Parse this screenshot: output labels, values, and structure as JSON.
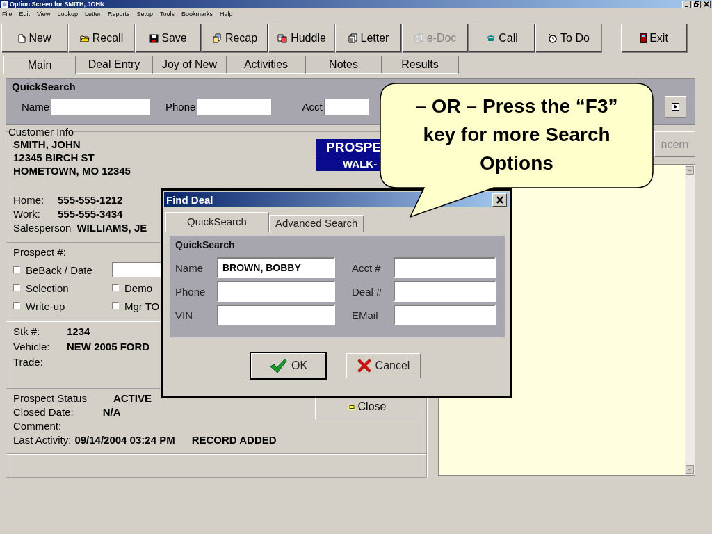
{
  "window": {
    "title": "Option Screen for SMITH, JOHN"
  },
  "menu": [
    "File",
    "Edit",
    "View",
    "Lookup",
    "Letter",
    "Reports",
    "Setup",
    "Tools",
    "Bookmarks",
    "Help"
  ],
  "toolbar": [
    {
      "label": "New",
      "disabled": false
    },
    {
      "label": "Recall",
      "disabled": false
    },
    {
      "label": "Save",
      "disabled": false
    },
    {
      "label": "Recap",
      "disabled": false
    },
    {
      "label": "Huddle",
      "disabled": false
    },
    {
      "label": "Letter",
      "disabled": false
    },
    {
      "label": "e-Doc",
      "disabled": true
    },
    {
      "label": "Call",
      "disabled": false
    },
    {
      "label": "To Do",
      "disabled": false
    },
    {
      "label": "Exit",
      "disabled": false
    }
  ],
  "tabs": [
    {
      "label": "Main",
      "selected": true
    },
    {
      "label": "Deal Entry",
      "selected": false
    },
    {
      "label": "Joy of New",
      "selected": false
    },
    {
      "label": "Activities",
      "selected": false
    },
    {
      "label": "Notes",
      "selected": false
    },
    {
      "label": "Results",
      "selected": false
    }
  ],
  "quick_search": {
    "title": "QuickSearch",
    "fields": [
      {
        "label": "Name"
      },
      {
        "label": "Phone"
      },
      {
        "label": "Acct"
      }
    ]
  },
  "customer_info": {
    "legend": "Customer Info",
    "address": [
      "SMITH, JOHN",
      "12345 BIRCH ST",
      "HOMETOWN, MO  12345"
    ],
    "banner": [
      "PROSPE",
      "WALK-"
    ],
    "contacts": [
      {
        "label": "Home:",
        "value": "555-555-1212"
      },
      {
        "label": "Work:",
        "value": "555-555-3434"
      },
      {
        "label": "Salesperson",
        "value": "WILLIAMS, JE"
      }
    ],
    "prospect_label": "Prospect #:",
    "checks": [
      {
        "label": "BeBack / Date",
        "checked": false
      },
      {
        "label": "Selection",
        "checked": false
      },
      {
        "label": "Demo",
        "checked": false
      },
      {
        "label": "Write-up",
        "checked": false
      },
      {
        "label": "Mgr TO",
        "checked": false
      }
    ],
    "vehicle": [
      {
        "label": "Stk #:",
        "value": "1234"
      },
      {
        "label": "Vehicle:",
        "value": "NEW 2005 FORD"
      },
      {
        "label": "Trade:"
      }
    ],
    "status": [
      {
        "label": "Prospect Status",
        "value": "ACTIVE"
      },
      {
        "label": "Closed Date:",
        "value": "N/A"
      },
      {
        "label": "Comment:"
      },
      {
        "label": "Last Activity:",
        "value": "09/14/2004 03:24 PM",
        "extra": "RECORD ADDED"
      }
    ],
    "close_button": "Close"
  },
  "concern_button": {
    "label": "ncern",
    "disabled": true
  },
  "dialog": {
    "title": "Find Deal",
    "tabs": [
      {
        "label": "QuickSearch",
        "selected": true
      },
      {
        "label": "Advanced Search",
        "selected": false
      }
    ],
    "group_title": "QuickSearch",
    "fields": [
      {
        "label": "Name",
        "value": "BROWN, BOBBY"
      },
      {
        "label": "Acct #"
      },
      {
        "label": "Phone"
      },
      {
        "label": "Deal #"
      },
      {
        "label": "VIN"
      },
      {
        "label": "EMail"
      }
    ],
    "buttons": [
      "OK",
      "Cancel"
    ]
  },
  "callout": {
    "text": "– OR – Press the “F3” key for more Search Options"
  }
}
